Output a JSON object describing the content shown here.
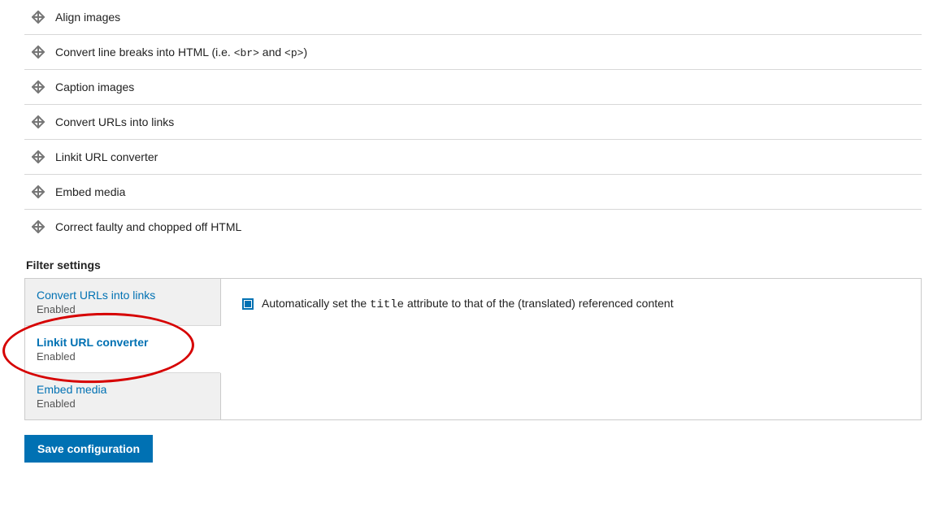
{
  "filters": [
    {
      "label": "Align images"
    },
    {
      "label_pre": "Convert line breaks into HTML (i.e. ",
      "code1": "<br>",
      "mid": " and ",
      "code2": "<p>",
      "label_post": ")"
    },
    {
      "label": "Caption images"
    },
    {
      "label": "Convert URLs into links"
    },
    {
      "label": "Linkit URL converter"
    },
    {
      "label": "Embed media"
    },
    {
      "label": "Correct faulty and chopped off HTML"
    }
  ],
  "section_heading": "Filter settings",
  "tabs": [
    {
      "title": "Convert URLs into links",
      "sub": "Enabled"
    },
    {
      "title": "Linkit URL converter",
      "sub": "Enabled"
    },
    {
      "title": "Embed media",
      "sub": "Enabled"
    }
  ],
  "checkbox": {
    "pre": "Automatically set the ",
    "code": "title",
    "post": " attribute to that of the (translated) referenced content"
  },
  "save_label": "Save configuration"
}
